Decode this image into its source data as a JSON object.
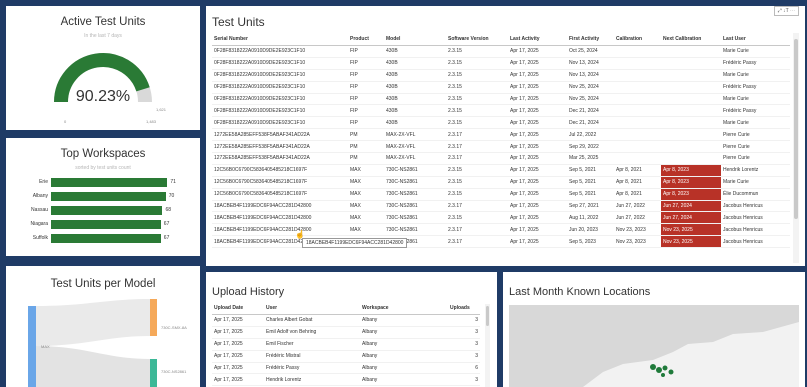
{
  "active_units": {
    "title": "Active Test Units",
    "subtitle": "In the last 7 days",
    "value": "90.23%",
    "gauge_fraction": 0.9023,
    "min_label": "0",
    "max_label": "1,483",
    "target_label": "1,621",
    "colors": {
      "fill": "#2a7a35",
      "empty": "#d9d9d9"
    }
  },
  "top_workspaces": {
    "title": "Top Workspaces",
    "subtitle": "sorted by test units count",
    "bar_color": "#2a7a35",
    "items": [
      {
        "label": "Erie",
        "value": 71
      },
      {
        "label": "Albany",
        "value": 70
      },
      {
        "label": "Nassau",
        "value": 68
      },
      {
        "label": "Niagara",
        "value": 67
      },
      {
        "label": "Suffolk",
        "value": 67
      }
    ]
  },
  "units_per_model": {
    "title": "Test Units per Model",
    "source_label": "MAX",
    "targets": [
      {
        "label": "730C-SMX-8A",
        "color": "#f5a95a"
      },
      {
        "label": "730C-NS2861",
        "color": "#3cb897"
      }
    ]
  },
  "test_units": {
    "title": "Test Units",
    "toolbar_label": "⤢ ↓T ⋯",
    "columns": [
      "Serial Number",
      "Product",
      "Model",
      "Software Version",
      "Last Activity",
      "First Activity",
      "Calibration",
      "Next Calibration",
      "Last User"
    ],
    "rows": [
      [
        "0F28F8318222A0910D9DE2E923C1F10",
        "FIP",
        "430B",
        "2.3.15",
        "Apr 17, 2025",
        "Oct 25, 2024",
        "",
        "",
        "Marie Curie"
      ],
      [
        "0F28F8318222A0910D9DE2E923C1F10",
        "FIP",
        "430B",
        "2.3.15",
        "Apr 17, 2025",
        "Nov 13, 2024",
        "",
        "",
        "Frédéric Passy"
      ],
      [
        "0F28F8318222A0910D9DE2E923C1F10",
        "FIP",
        "430B",
        "2.3.15",
        "Apr 17, 2025",
        "Nov 13, 2024",
        "",
        "",
        "Marie Curie"
      ],
      [
        "0F28F8318222A0910D9DE2E923C1F10",
        "FIP",
        "430B",
        "2.3.15",
        "Apr 17, 2025",
        "Nov 25, 2024",
        "",
        "",
        "Frédéric Passy"
      ],
      [
        "0F28F8318222A0910D9DE2E923C1F10",
        "FIP",
        "430B",
        "2.3.15",
        "Apr 17, 2025",
        "Nov 25, 2024",
        "",
        "",
        "Marie Curie"
      ],
      [
        "0F28F8318222A0910D9DE2E923C1F10",
        "FIP",
        "430B",
        "2.3.15",
        "Apr 17, 2025",
        "Dec 21, 2024",
        "",
        "",
        "Frédéric Passy"
      ],
      [
        "0F28F8318222A0910D9DE2E923C1F10",
        "FIP",
        "430B",
        "2.3.15",
        "Apr 17, 2025",
        "Dec 21, 2024",
        "",
        "",
        "Marie Curie"
      ],
      [
        "1272EE58A285EFF538F5ABAF341AD22A",
        "PM",
        "MAX-2X-VFL",
        "2.3.17",
        "Apr 17, 2025",
        "Jul 22, 2022",
        "",
        "",
        "Pierre Curie"
      ],
      [
        "1272EE58A285EFF538F5ABAF341AD22A",
        "PM",
        "MAX-2X-VFL",
        "2.3.17",
        "Apr 17, 2025",
        "Sep 29, 2022",
        "",
        "",
        "Pierre Curie"
      ],
      [
        "1272EE58A285EFF538F5ABAF341AD22A",
        "PM",
        "MAX-2X-VFL",
        "2.3.17",
        "Apr 17, 2025",
        "Mar 25, 2025",
        "",
        "",
        "Pierre Curie"
      ],
      [
        "12C56B0C6790C5836405485218C1697F",
        "MAX",
        "730C-NS2861",
        "2.3.15",
        "Apr 17, 2025",
        "Sep 5, 2021",
        "Apr 8, 2021",
        "Apr 8, 2023",
        "Hendrik Lorentz"
      ],
      [
        "12C56B0C6790C5836405485218C1697F",
        "MAX",
        "730C-NS2861",
        "2.3.15",
        "Apr 17, 2025",
        "Sep 5, 2021",
        "Apr 8, 2021",
        "Apr 8, 2023",
        "Marie Curie"
      ],
      [
        "12C56B0C6790C5836405485218C1697F",
        "MAX",
        "730C-NS2861",
        "2.3.15",
        "Apr 17, 2025",
        "Sep 5, 2021",
        "Apr 8, 2021",
        "Apr 8, 2023",
        "Élie Ducommun"
      ],
      [
        "18ACBEB4F1199EDC6F94ACC281D42800",
        "MAX",
        "730C-NS2861",
        "2.3.17",
        "Apr 17, 2025",
        "Sep 27, 2021",
        "Jun 27, 2022",
        "Jun 27, 2024",
        "Jacobus Henricus"
      ],
      [
        "18ACBEB4F1199EDC6F94ACC281D42800",
        "MAX",
        "730C-NS2861",
        "2.3.15",
        "Apr 17, 2025",
        "Aug 11, 2022",
        "Jun 27, 2022",
        "Jun 27, 2024",
        "Jacobus Henricus"
      ],
      [
        "18ACBEB4F1199EDC6F94ACC281D42800",
        "MAX",
        "730C-NS2861",
        "2.3.17",
        "Apr 17, 2025",
        "Jun 20, 2023",
        "Nov 23, 2023",
        "Nov 23, 2025",
        "Jacobus Henricus"
      ],
      [
        "18ACBEB4F1199EDC6F94ACC281D42800",
        "MAX",
        "730C-NS2861",
        "2.3.17",
        "Apr 17, 2025",
        "Sep 5, 2023",
        "Nov 23, 2023",
        "Nov 23, 2025",
        "Jacobus Henricus"
      ]
    ],
    "highlight_color": "#b83227",
    "tooltip": "18ACBEB4F1199EDC6F94ACC281D42800"
  },
  "upload_history": {
    "title": "Upload History",
    "columns": [
      "Upload Date",
      "User",
      "Workspace",
      "Uploads"
    ],
    "rows": [
      [
        "Apr 17, 2025",
        "Charles Albert Gobat",
        "Albany",
        "3"
      ],
      [
        "Apr 17, 2025",
        "Emil Adolf von Behring",
        "Albany",
        "3"
      ],
      [
        "Apr 17, 2025",
        "Emil Fischer",
        "Albany",
        "3"
      ],
      [
        "Apr 17, 2025",
        "Frédéric Mistral",
        "Albany",
        "3"
      ],
      [
        "Apr 17, 2025",
        "Frédéric Passy",
        "Albany",
        "6"
      ],
      [
        "Apr 17, 2025",
        "Hendrik Lorentz",
        "Albany",
        "3"
      ]
    ]
  },
  "map": {
    "title": "Last Month Known Locations",
    "land_color": "#d8d8d8",
    "point_color": "#1f7a3a"
  }
}
